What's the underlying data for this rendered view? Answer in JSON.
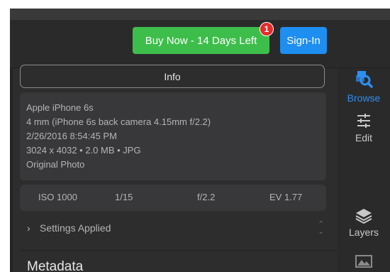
{
  "header": {
    "buy_now_label": "Buy Now - 14 Days Left",
    "notification_count": "1",
    "sign_in_label": "Sign-In"
  },
  "info": {
    "title": "Info",
    "device": "Apple iPhone 6s",
    "lens": "4 mm (iPhone 6s back camera 4.15mm f/2.2)",
    "datetime": "2/26/2016 8:54:45 PM",
    "file_details": "3024 x 4032 • 2.0 MB • JPG",
    "photo_type": "Original Photo"
  },
  "exif": {
    "iso": "ISO 1000",
    "shutter": "1/15",
    "aperture": "f/2.2",
    "ev": "EV 1.77"
  },
  "settings_applied_label": "Settings Applied",
  "metadata_title": "Metadata",
  "sidebar": {
    "items": [
      {
        "label": "Browse",
        "icon": "browse-icon",
        "active": true
      },
      {
        "label": "Edit",
        "icon": "sliders-icon",
        "active": false
      },
      {
        "label": "Layers",
        "icon": "layers-icon",
        "active": false
      },
      {
        "label": "",
        "icon": "image-icon",
        "active": false
      }
    ]
  },
  "colors": {
    "buy_button": "#3dbe4b",
    "sign_in_button": "#1e8ef0",
    "badge": "#e52b2b",
    "active_nav": "#2d8ff0",
    "background": "#2f2f30"
  }
}
